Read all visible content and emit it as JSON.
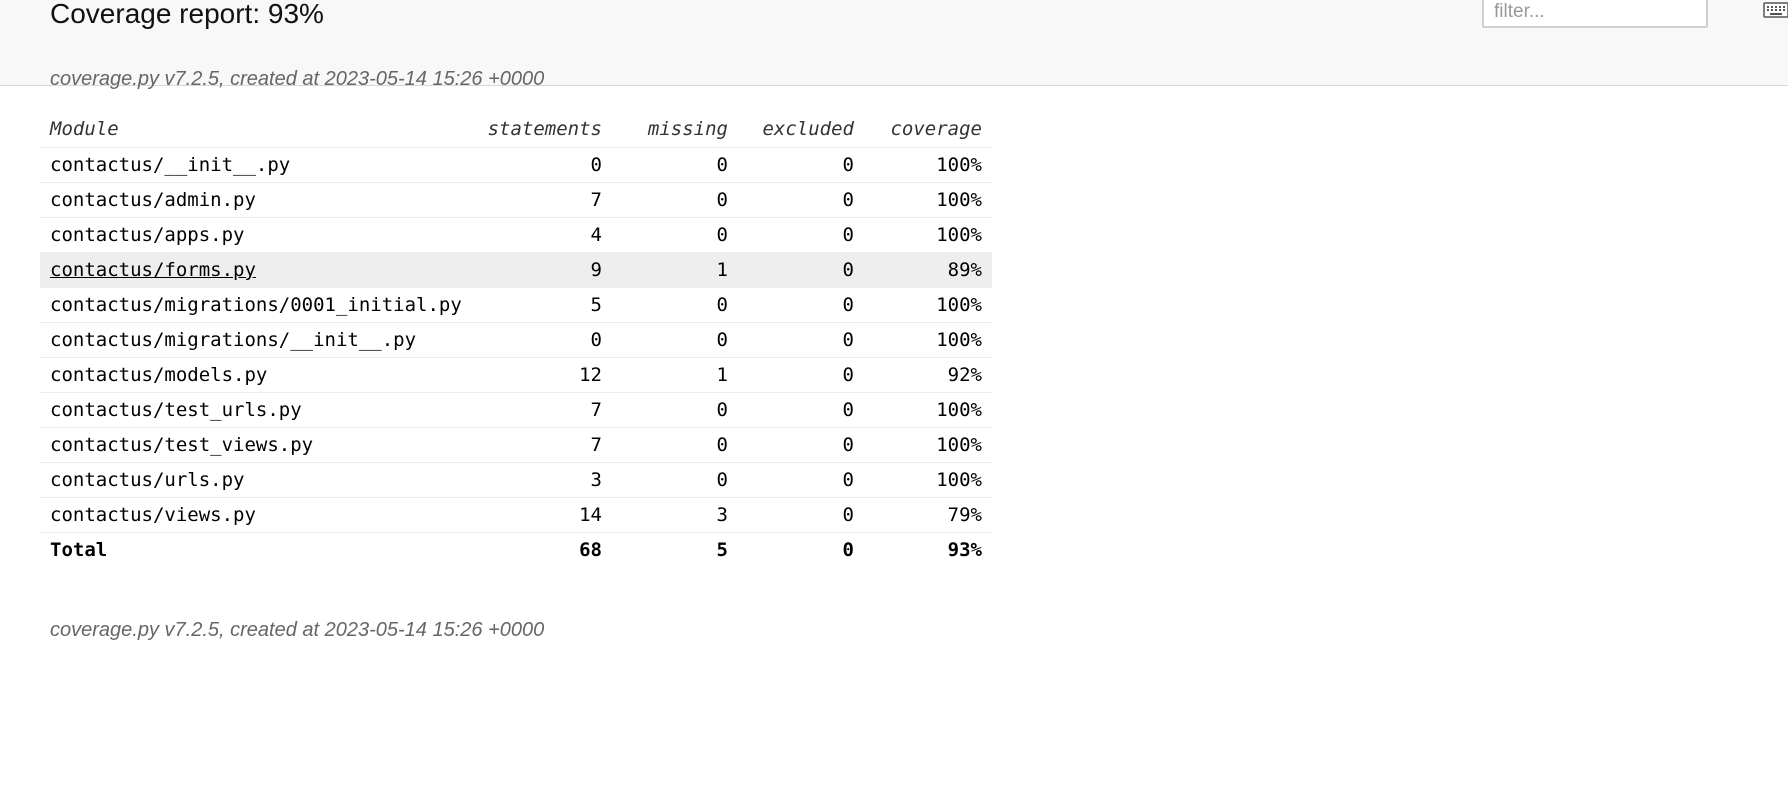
{
  "header": {
    "title": "Coverage report: 93%",
    "created": "coverage.py v7.2.5, created at 2023-05-14 15:26 +0000",
    "filter_placeholder": "filter..."
  },
  "icons": {
    "keyboard": "keyboard-icon"
  },
  "colors": {
    "header_background": "#f8f8f8",
    "hover_row_background": "#eeeeee",
    "muted_text": "#666666"
  },
  "table": {
    "columns": [
      "Module",
      "statements",
      "missing",
      "excluded",
      "coverage"
    ],
    "rows": [
      {
        "module": "contactus/__init__.py",
        "statements": "0",
        "missing": "0",
        "excluded": "0",
        "coverage": "100%"
      },
      {
        "module": "contactus/admin.py",
        "statements": "7",
        "missing": "0",
        "excluded": "0",
        "coverage": "100%"
      },
      {
        "module": "contactus/apps.py",
        "statements": "4",
        "missing": "0",
        "excluded": "0",
        "coverage": "100%"
      },
      {
        "module": "contactus/forms.py",
        "statements": "9",
        "missing": "1",
        "excluded": "0",
        "coverage": "89%"
      },
      {
        "module": "contactus/migrations/0001_initial.py",
        "statements": "5",
        "missing": "0",
        "excluded": "0",
        "coverage": "100%"
      },
      {
        "module": "contactus/migrations/__init__.py",
        "statements": "0",
        "missing": "0",
        "excluded": "0",
        "coverage": "100%"
      },
      {
        "module": "contactus/models.py",
        "statements": "12",
        "missing": "1",
        "excluded": "0",
        "coverage": "92%"
      },
      {
        "module": "contactus/test_urls.py",
        "statements": "7",
        "missing": "0",
        "excluded": "0",
        "coverage": "100%"
      },
      {
        "module": "contactus/test_views.py",
        "statements": "7",
        "missing": "0",
        "excluded": "0",
        "coverage": "100%"
      },
      {
        "module": "contactus/urls.py",
        "statements": "3",
        "missing": "0",
        "excluded": "0",
        "coverage": "100%"
      },
      {
        "module": "contactus/views.py",
        "statements": "14",
        "missing": "3",
        "excluded": "0",
        "coverage": "79%"
      }
    ],
    "total": {
      "label": "Total",
      "statements": "68",
      "missing": "5",
      "excluded": "0",
      "coverage": "93%"
    }
  },
  "footer": {
    "created": "coverage.py v7.2.5, created at 2023-05-14 15:26 +0000"
  }
}
